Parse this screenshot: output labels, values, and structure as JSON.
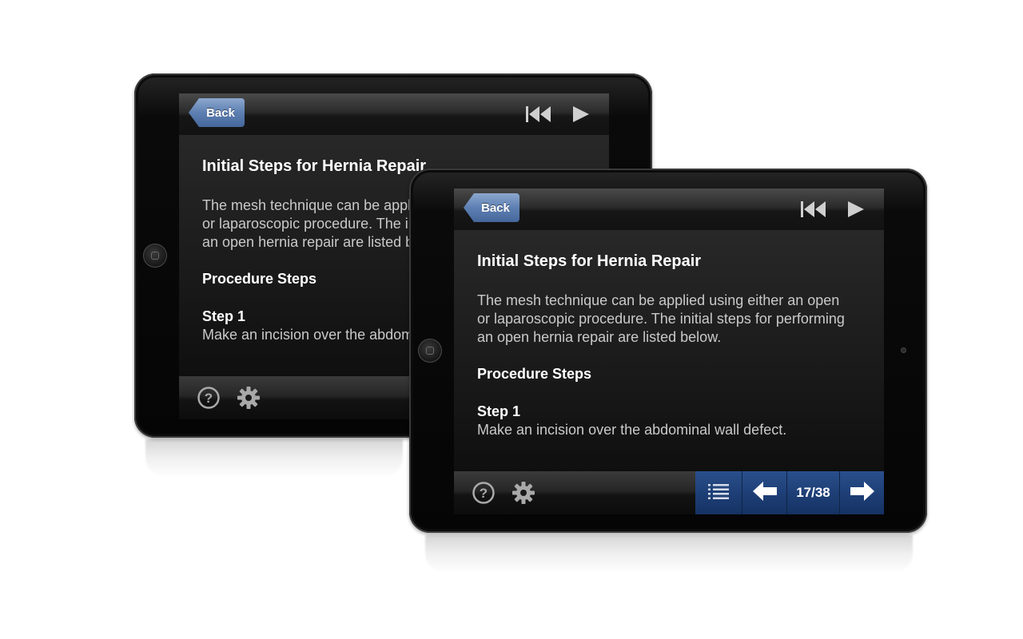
{
  "screen": {
    "back_label": "Back",
    "title": "Initial Steps for Hernia Repair",
    "intro": "The mesh technique can be applied using either an open\nor laparoscopic procedure. The initial steps for performing\nan open hernia repair are listed below.",
    "section_heading": "Procedure Steps",
    "step_title": "Step 1",
    "step_text": "Make an incision over the abdominal wall defect.",
    "page_indicator": "17/38"
  },
  "icons": {
    "header": [
      "rewind-icon",
      "play-icon"
    ],
    "footer": [
      "help-icon",
      "gear-icon"
    ],
    "nav": [
      "list-icon",
      "arrow-left-icon",
      "arrow-right-icon"
    ]
  },
  "colors": {
    "back_button": "#5d7fb2",
    "nav_bar": "#1d3e75",
    "text_primary": "#ffffff",
    "text_secondary": "#c9c9c9"
  }
}
